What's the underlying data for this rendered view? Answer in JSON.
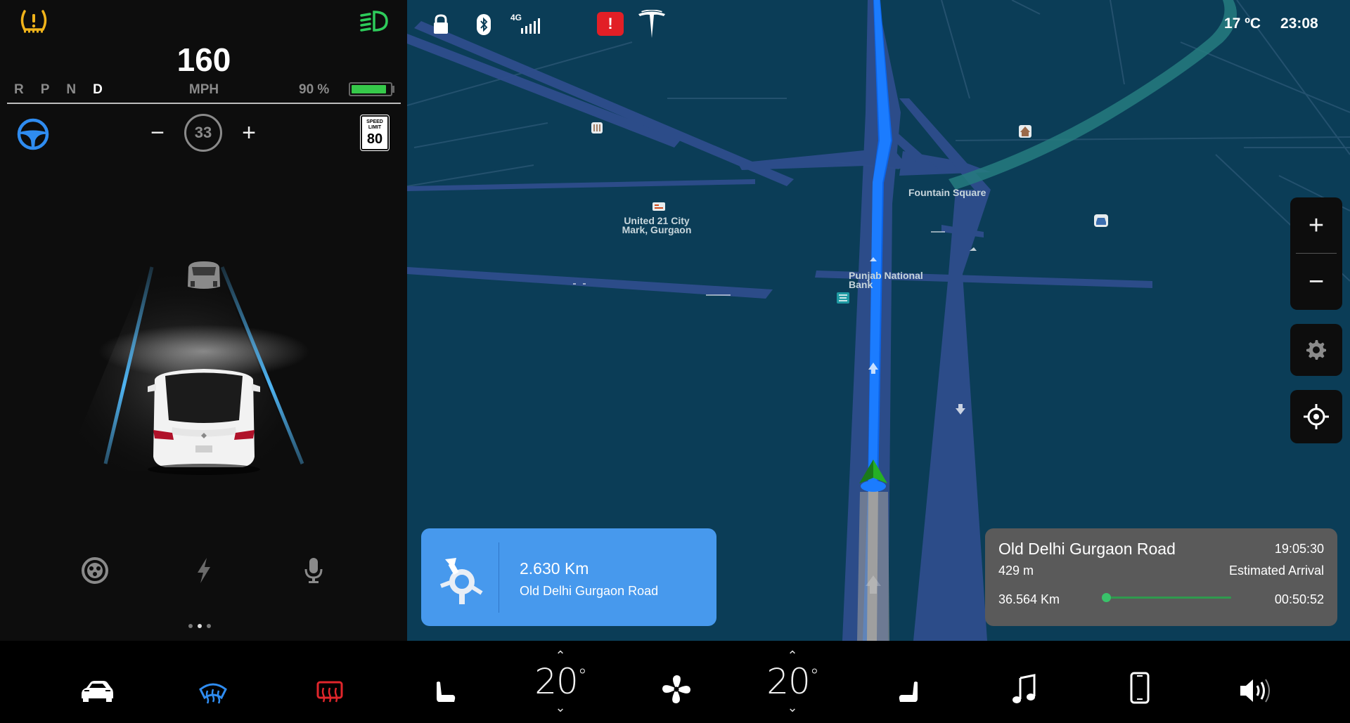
{
  "drive": {
    "speed": "160",
    "speed_unit": "MPH",
    "gears": [
      {
        "label": "R",
        "active": false
      },
      {
        "label": "P",
        "active": false
      },
      {
        "label": "N",
        "active": false
      },
      {
        "label": "D",
        "active": true
      }
    ],
    "battery_percent_label": "90 %",
    "battery_level": 0.9,
    "cruise": {
      "minus": "−",
      "value": "33",
      "plus": "+"
    },
    "speed_limit": {
      "top": "SPEED LIMIT",
      "value": "80"
    }
  },
  "status_bar": {
    "network": "4G",
    "temperature": "17 ºC",
    "clock": "23:08"
  },
  "map": {
    "labels": {
      "fountain_square": "Fountain Square",
      "united21": "United 21 City Mark, Gurgaon",
      "pnb": "Punjab National Bank"
    },
    "zoom_in": "+",
    "zoom_out": "−"
  },
  "nav_card": {
    "distance": "2.630 Km",
    "road": "Old Delhi Gurgaon Road"
  },
  "eta_card": {
    "road": "Old Delhi Gurgaon Road",
    "arrival_time": "19:05:30",
    "next_distance": "429 m",
    "arrival_label": "Estimated Arrival",
    "total_distance": "36.564 Km",
    "remaining_time": "00:50:52",
    "progress": 0.02
  },
  "climate": {
    "driver_temp": "20",
    "passenger_temp": "20",
    "degree_symbol": "°"
  },
  "colors": {
    "accent_blue": "#4799ed",
    "tpms_warning": "#f0b31a",
    "headlight_green": "#2ecc5b",
    "defrost_blue": "#2f8cf0",
    "rear_defrost_red": "#e0262b",
    "battery_green": "#36c94a",
    "alert_red": "#e21f26"
  },
  "icons": [
    "tpms-warning-icon",
    "headlight-icon",
    "steering-wheel-icon",
    "tires-icon",
    "bolt-icon",
    "mic-icon",
    "lock-icon",
    "bluetooth-icon",
    "signal-icon",
    "alert-icon",
    "tesla-logo",
    "car-icon",
    "front-defrost-icon",
    "rear-defrost-icon",
    "seat-left-icon",
    "fan-icon",
    "seat-right-icon",
    "music-icon",
    "phone-icon",
    "volume-icon",
    "settings-icon",
    "recenter-icon",
    "roundabout-icon"
  ]
}
